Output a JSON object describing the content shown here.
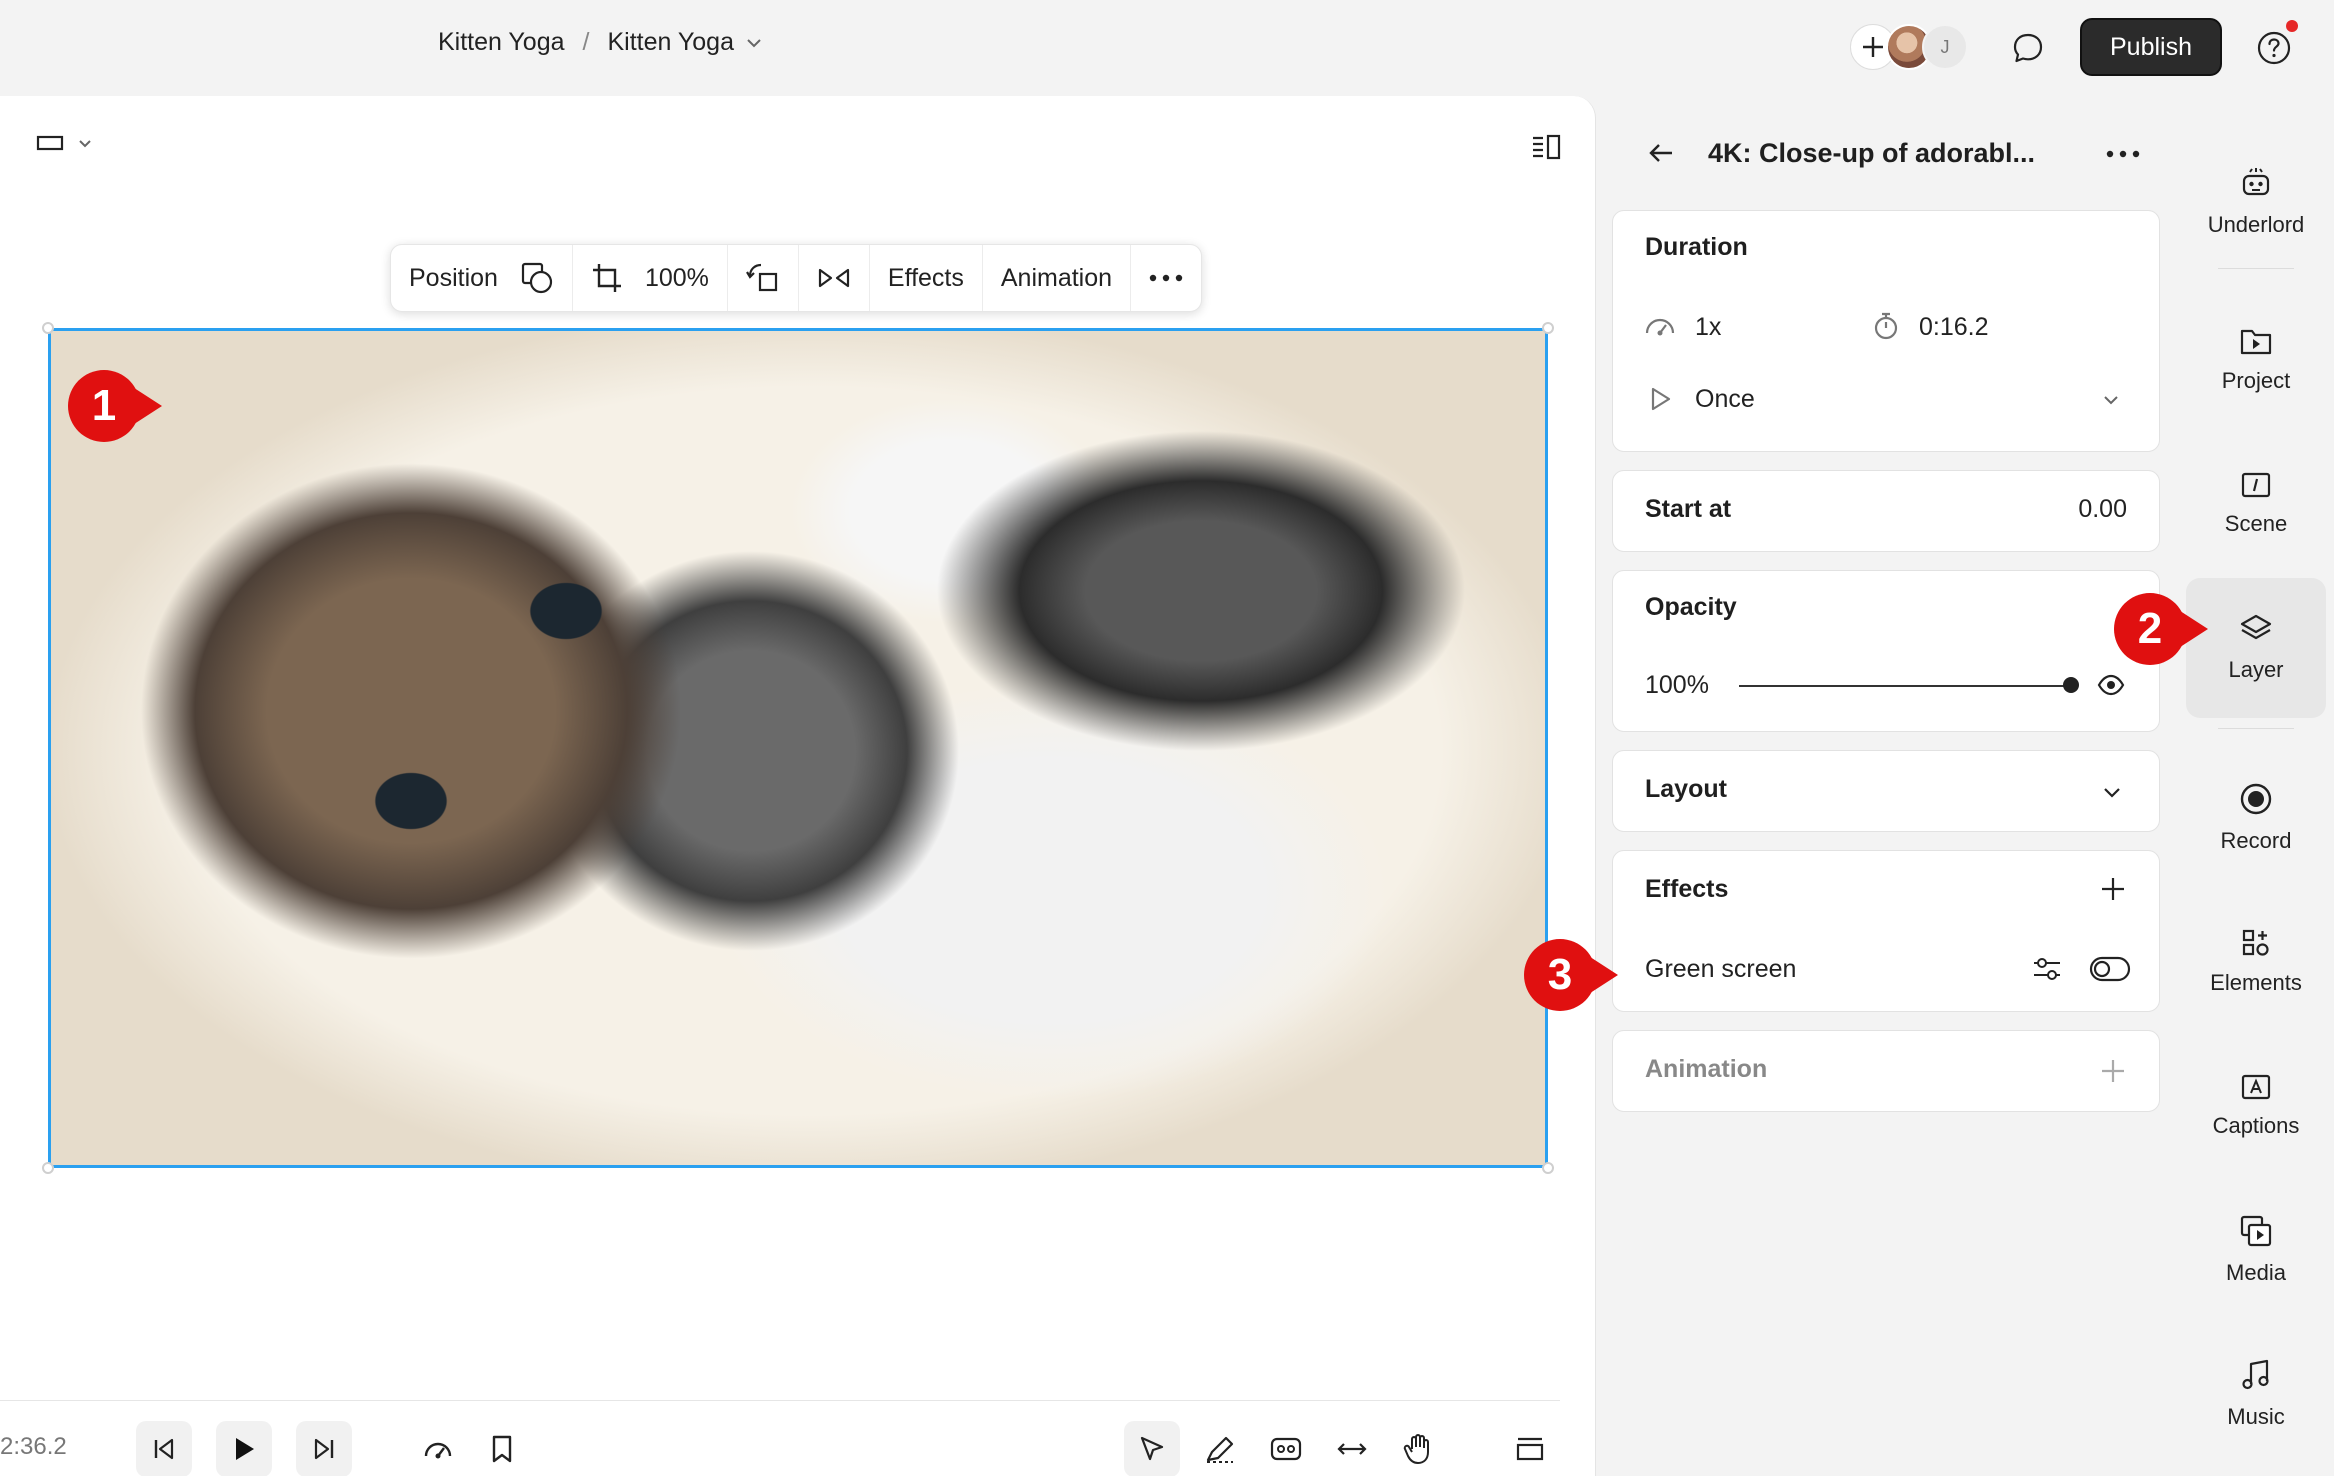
{
  "header": {
    "breadcrumb_project": "Kitten Yoga",
    "breadcrumb_sep": "/",
    "breadcrumb_scene": "Kitten Yoga",
    "avatar_initial": "J",
    "publish_label": "Publish"
  },
  "toolbar": {
    "position_label": "Position",
    "zoom_value": "100%",
    "effects_label": "Effects",
    "animation_label": "Animation"
  },
  "markers": [
    "1",
    "2",
    "3"
  ],
  "playback": {
    "timecode": "2:36.2"
  },
  "properties": {
    "title": "4K: Close-up of adorabl...",
    "duration": {
      "title": "Duration",
      "speed": "1x",
      "length": "0:16.2",
      "loop_mode": "Once"
    },
    "start_at": {
      "label": "Start at",
      "value": "0.00"
    },
    "opacity": {
      "title": "Opacity",
      "value_label": "100%",
      "value": 1.0
    },
    "layout": {
      "title": "Layout"
    },
    "effects": {
      "title": "Effects",
      "items": [
        {
          "label": "Green screen",
          "enabled": false
        }
      ]
    },
    "animation": {
      "title": "Animation"
    }
  },
  "rail": {
    "items": [
      {
        "label": "Underlord",
        "icon": "robot-icon"
      },
      {
        "label": "Project",
        "icon": "folder-play-icon"
      },
      {
        "label": "Scene",
        "icon": "scene-icon"
      },
      {
        "label": "Layer",
        "icon": "layers-icon",
        "active": true
      },
      {
        "label": "Record",
        "icon": "record-icon"
      },
      {
        "label": "Elements",
        "icon": "elements-icon"
      },
      {
        "label": "Captions",
        "icon": "captions-icon"
      },
      {
        "label": "Media",
        "icon": "media-icon"
      },
      {
        "label": "Music",
        "icon": "music-icon"
      }
    ]
  },
  "colors": {
    "accent_selection": "#2aa0f0",
    "marker_red": "#e01010",
    "publish_bg": "#2b2b2b",
    "notification_dot": "#e62727"
  }
}
